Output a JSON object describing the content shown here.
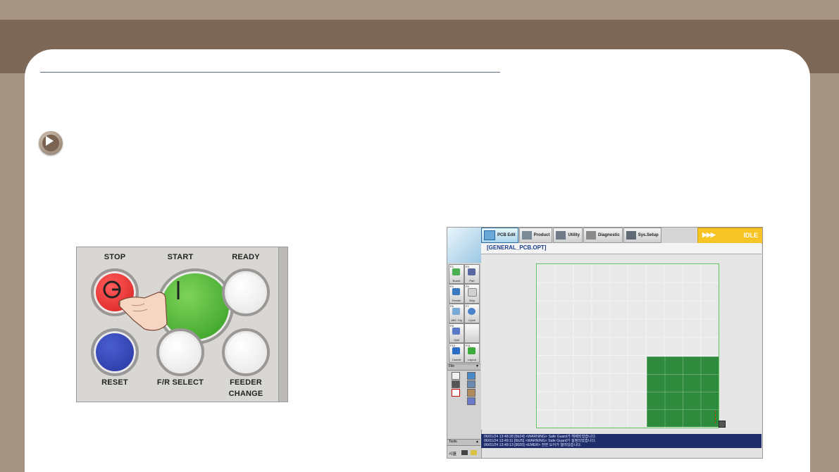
{
  "colors": {
    "band_top": "#a69585",
    "band_main": "#7d6757",
    "page_bg": "#ffffff",
    "stop_red": "#d41b1b",
    "start_green": "#2f9a1f",
    "reset_blue": "#24339c",
    "idle_yellow": "#f7c426",
    "log_bg": "#1f2d6b",
    "board_green": "#2e8a3c"
  },
  "panel": {
    "labels": {
      "stop": "STOP",
      "start": "START",
      "ready": "READY",
      "reset": "RESET",
      "fr_select": "F/R  SELECT",
      "feeder_change_1": "FEEDER",
      "feeder_change_2": "CHANGE"
    }
  },
  "app": {
    "tabs": [
      "PCB Edit",
      "Product",
      "Utility",
      "Diagnostic",
      "Sys.Setup"
    ],
    "status_arrows": "▶▶▶",
    "status": "IDLE",
    "file_name": "[GENERAL_PCB.OPT]",
    "side_buttons": [
      {
        "fkey": "F2",
        "label": "Board",
        "icon": "board-icon"
      },
      {
        "fkey": "F3",
        "label": "Part",
        "icon": "part-icon"
      },
      {
        "fkey": "F4",
        "label": "Feeder",
        "icon": "feeder-icon"
      },
      {
        "fkey": "F5",
        "label": "Step",
        "icon": "step-icon"
      },
      {
        "fkey": "F6",
        "label": "ABC Cfg",
        "icon": "abc-cfg-icon"
      },
      {
        "fkey": "F7",
        "label": "Cycle",
        "icon": "cycle-icon"
      },
      {
        "fkey": "F8",
        "label": "Opti",
        "icon": "opti-icon"
      },
      {
        "fkey": "",
        "label": "",
        "icon": ""
      },
      {
        "fkey": "F10",
        "label": "Cancel",
        "icon": "cancel-icon"
      },
      {
        "fkey": "F11",
        "label": "Layout",
        "icon": "layout-icon"
      }
    ],
    "file_section": "File",
    "tools_section": "Tools",
    "log_lines": [
      "06/01/24 13:48:28 [6b24] <WARNING> Safe Guard가 해제되었습니다.",
      "06/01/24 13:49:11 [6b25] <WARNING> Safe Guard가 설정되었습니다.",
      "06/01/24 13:49:13 [8020] <EMER> 전면 도어가 열려있습니다."
    ],
    "bottom_label": "시뮬"
  }
}
